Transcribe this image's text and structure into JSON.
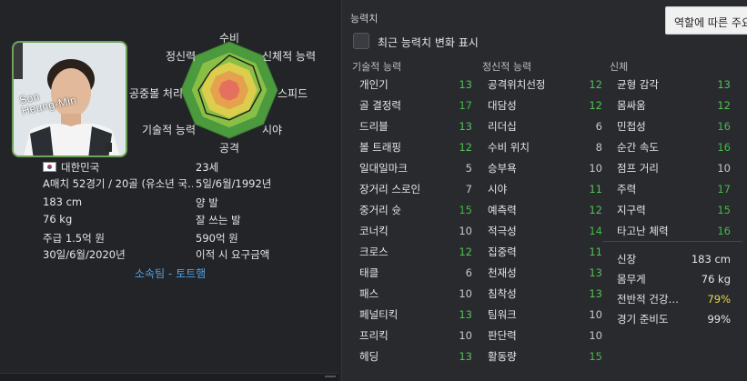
{
  "profile": {
    "avatar_name": "Son\nHeung-Min",
    "nationality": "대한민국",
    "age": "23세",
    "caps": "A매치 52경기 / 20골 (유소년 국…",
    "birth_date": "5일/6월/1992년",
    "height": "183 cm",
    "preferred_foot": "양 발",
    "weight": "76 kg",
    "foot_note": "잘 쓰는 발",
    "wage": "주급 1.5억 원",
    "value": "590억 원",
    "contract_end": "30일/6월/2020년",
    "transfer_status": "이적 시 요구금액",
    "club_label": "소속팀 - 토트햄"
  },
  "radar": {
    "axes": [
      "수비",
      "신체적 능력",
      "스피드",
      "시야",
      "공격",
      "기술적 능력",
      "공중볼 처리",
      "정신력"
    ]
  },
  "attributes": {
    "section_title": "능력치",
    "role_button": "역할에 따른 주요",
    "show_changes_label": "최근 능력치 변화 표시",
    "technical_header": "기술적 능력",
    "mental_header": "정신적 능력",
    "physical_header": "신체",
    "technical": [
      {
        "name": "개인기",
        "value": "13",
        "tier": "good"
      },
      {
        "name": "골 결정력",
        "value": "17",
        "tier": "high"
      },
      {
        "name": "드리블",
        "value": "13",
        "tier": "good"
      },
      {
        "name": "볼 트래핑",
        "value": "12",
        "tier": "good"
      },
      {
        "name": "일대일마크",
        "value": "5",
        "tier": "mid"
      },
      {
        "name": "장거리 스로인",
        "value": "7",
        "tier": "mid"
      },
      {
        "name": "중거리 슛",
        "value": "15",
        "tier": "high"
      },
      {
        "name": "코너킥",
        "value": "10",
        "tier": "mid"
      },
      {
        "name": "크로스",
        "value": "12",
        "tier": "good"
      },
      {
        "name": "태클",
        "value": "6",
        "tier": "mid"
      },
      {
        "name": "패스",
        "value": "10",
        "tier": "mid"
      },
      {
        "name": "페널티킥",
        "value": "13",
        "tier": "good"
      },
      {
        "name": "프리킥",
        "value": "10",
        "tier": "mid"
      },
      {
        "name": "헤딩",
        "value": "13",
        "tier": "good"
      }
    ],
    "mental": [
      {
        "name": "공격위치선정",
        "value": "12",
        "tier": "good"
      },
      {
        "name": "대담성",
        "value": "12",
        "tier": "good"
      },
      {
        "name": "리더십",
        "value": "6",
        "tier": "mid"
      },
      {
        "name": "수비 위치",
        "value": "8",
        "tier": "mid"
      },
      {
        "name": "승부욕",
        "value": "10",
        "tier": "mid"
      },
      {
        "name": "시야",
        "value": "11",
        "tier": "good"
      },
      {
        "name": "예측력",
        "value": "12",
        "tier": "good"
      },
      {
        "name": "적극성",
        "value": "14",
        "tier": "high"
      },
      {
        "name": "집중력",
        "value": "11",
        "tier": "good"
      },
      {
        "name": "천재성",
        "value": "13",
        "tier": "good"
      },
      {
        "name": "침착성",
        "value": "13",
        "tier": "good"
      },
      {
        "name": "팀워크",
        "value": "10",
        "tier": "mid"
      },
      {
        "name": "판단력",
        "value": "10",
        "tier": "mid"
      },
      {
        "name": "활동량",
        "value": "15",
        "tier": "high"
      }
    ],
    "physical": [
      {
        "name": "균형 감각",
        "value": "13",
        "tier": "good"
      },
      {
        "name": "몸싸움",
        "value": "12",
        "tier": "good"
      },
      {
        "name": "민첩성",
        "value": "16",
        "tier": "high"
      },
      {
        "name": "순간 속도",
        "value": "16",
        "tier": "high"
      },
      {
        "name": "점프 거리",
        "value": "10",
        "tier": "mid"
      },
      {
        "name": "주력",
        "value": "17",
        "tier": "high"
      },
      {
        "name": "지구력",
        "value": "15",
        "tier": "high"
      },
      {
        "name": "타고난 체력",
        "value": "16",
        "tier": "high"
      }
    ],
    "body": [
      {
        "name": "신장",
        "value": "183 cm",
        "warn": false
      },
      {
        "name": "몸무게",
        "value": "76 kg",
        "warn": false
      },
      {
        "name": "전반적 건강…",
        "value": "79%",
        "warn": true
      },
      {
        "name": "경기 준비도",
        "value": "99%",
        "warn": false
      }
    ]
  },
  "colors": {
    "background": "#232428",
    "panel": "#282a2e",
    "good": "#55c055",
    "mid": "#c9c9c9",
    "link": "#4ea3e6",
    "warn": "#e8d84a"
  }
}
